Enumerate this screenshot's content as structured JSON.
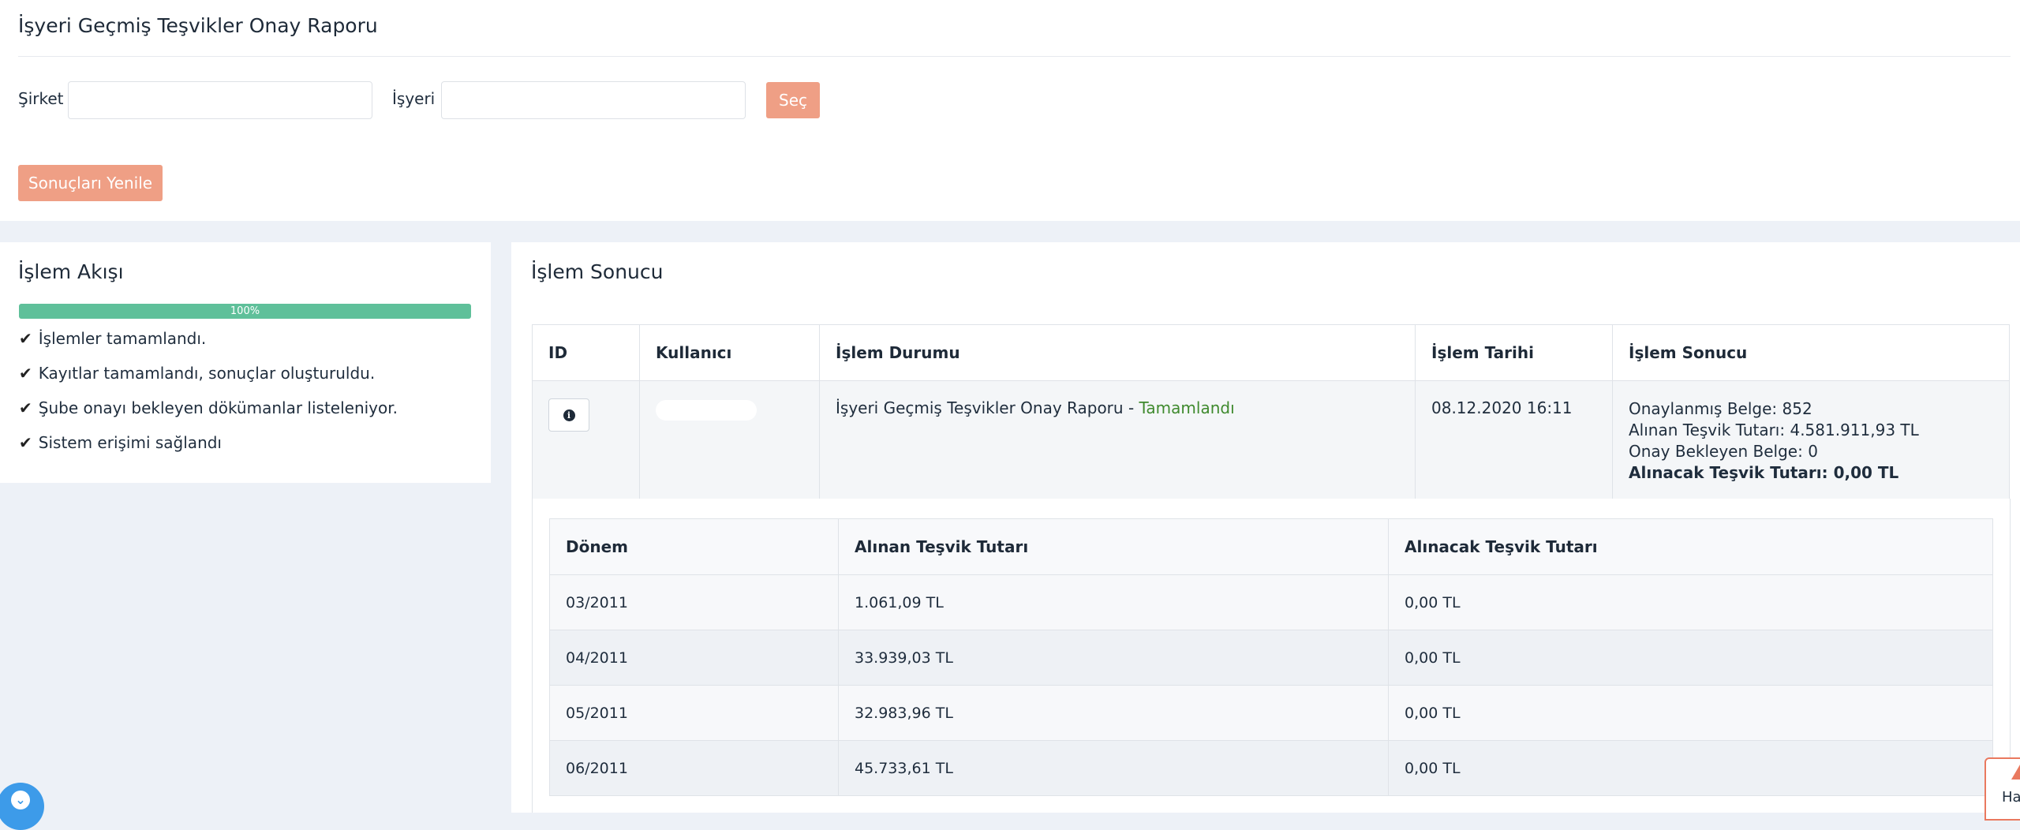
{
  "page": {
    "title": "İşyeri Geçmiş Teşvikler Onay Raporu"
  },
  "filters": {
    "company_label": "Şirket",
    "company_value": "",
    "workplace_label": "İşyeri",
    "workplace_value": "",
    "select_button": "Seç",
    "refresh_button": "Sonuçları Yenile"
  },
  "flow": {
    "title": "İşlem Akışı",
    "progress_percent": 100,
    "progress_label": "100%",
    "steps": [
      "İşlemler tamamlandı.",
      "Kayıtlar tamamlandı, sonuçlar oluşturuldu.",
      "Şube onayı bekleyen dökümanlar listeleniyor.",
      "Sistem erişimi sağlandı"
    ],
    "check_icon": "check-icon"
  },
  "result": {
    "title": "İşlem Sonucu",
    "columns": [
      "ID",
      "Kullanıcı",
      "İşlem Durumu",
      "İşlem Tarihi",
      "İşlem Sonucu"
    ],
    "row": {
      "info_icon": "info-icon",
      "status_text": "İşyeri Geçmiş Teşvikler Onay Raporu - ",
      "status_value": "Tamamlandı",
      "date": "08.12.2020 16:11",
      "summary": [
        "Onaylanmış Belge: 852",
        "Alınan Teşvik Tutarı: 4.581.911,93 TL",
        "Onay Bekleyen Belge: 0",
        "Alınacak Teşvik Tutarı: 0,00 TL"
      ]
    },
    "detail": {
      "columns": [
        "Dönem",
        "Alınan Teşvik Tutarı",
        "Alınacak Teşvik Tutarı"
      ],
      "rows": [
        [
          "03/2011",
          "1.061,09 TL",
          "0,00 TL"
        ],
        [
          "04/2011",
          "33.939,03 TL",
          "0,00 TL"
        ],
        [
          "05/2011",
          "32.983,96 TL",
          "0,00 TL"
        ],
        [
          "06/2011",
          "45.733,61 TL",
          "0,00 TL"
        ]
      ]
    }
  },
  "widgets": {
    "help_label": "Ha",
    "chat_icon": "chevron-down-icon",
    "help_icon": "warning-icon"
  },
  "colors": {
    "accent": "#ef9f85",
    "progress": "#5fc09a",
    "success": "#3f8a2e",
    "chat": "#3d9be9"
  }
}
